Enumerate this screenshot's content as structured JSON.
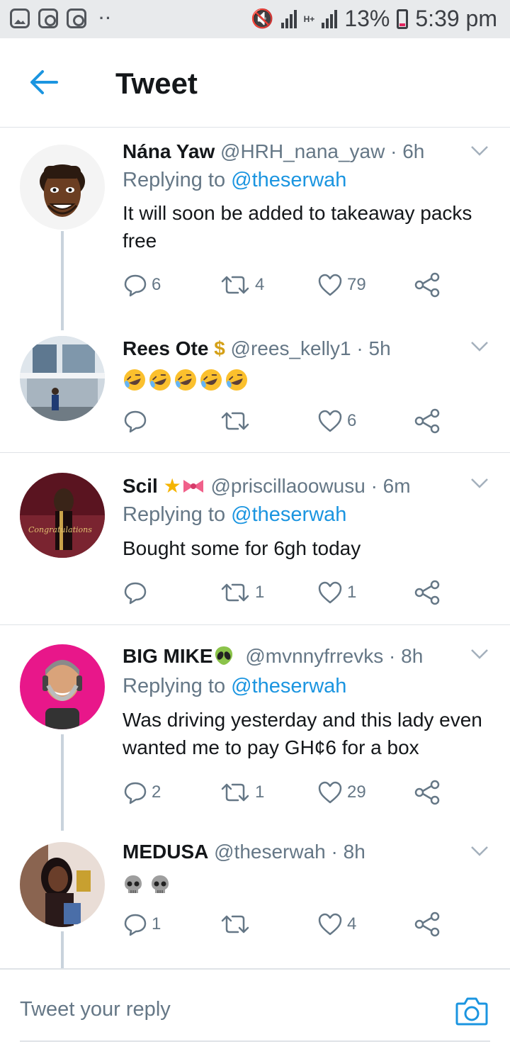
{
  "status_bar": {
    "battery": "13%",
    "time": "5:39 pm",
    "network": "H+"
  },
  "header": {
    "title": "Tweet"
  },
  "tweets": [
    {
      "name": "Nána Yaw",
      "handle": "@HRH_nana_yaw",
      "time": "6h",
      "replying_label": "Replying to",
      "replying_to": "@theserwah",
      "text": "It will soon be added to takeaway packs free",
      "replies": "6",
      "retweets": "4",
      "likes": "79"
    },
    {
      "name": "Rees Ote",
      "name_emoji": "$",
      "handle": "@rees_kelly1",
      "time": "5h",
      "emoji_count": 5,
      "emoji": "rolling-on-floor-laughing",
      "replies": "",
      "retweets": "",
      "likes": "6"
    },
    {
      "name": "Scil",
      "handle": "@priscillaoowusu",
      "time": "6m",
      "replying_label": "Replying to",
      "replying_to": "@theserwah",
      "text": "Bought some for 6gh today",
      "replies": "",
      "retweets": "1",
      "likes": "1"
    },
    {
      "name": "BIG MIKE",
      "handle": "@mvnnyfrrevks",
      "time": "8h",
      "replying_label": "Replying to",
      "replying_to": "@theserwah",
      "text": "Was driving yesterday and this lady even wanted me to pay GH¢6 for a box",
      "replies": "2",
      "retweets": "1",
      "likes": "29"
    },
    {
      "name": "MEDUSA",
      "handle": "@theserwah",
      "time": "8h",
      "emoji_count": 2,
      "emoji": "skull",
      "replies": "1",
      "retweets": "",
      "likes": "4"
    }
  ],
  "reply_bar": {
    "placeholder": "Tweet your reply"
  },
  "icons": {
    "back": "back-arrow-icon",
    "caret": "chevron-down-icon",
    "reply": "reply-bubble-icon",
    "retweet": "retweet-icon",
    "like": "heart-icon",
    "share": "share-icon",
    "camera": "camera-icon"
  },
  "colors": {
    "accent": "#1b95e0",
    "secondary_text": "#657786",
    "primary_text": "#14171a",
    "divider": "#dfe3e7"
  }
}
